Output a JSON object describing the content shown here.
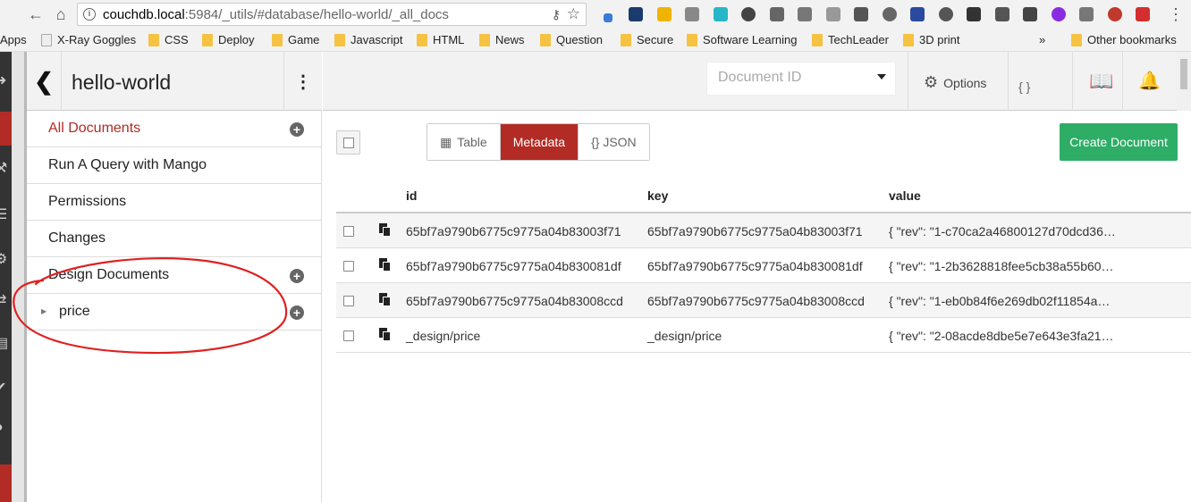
{
  "browser": {
    "url_host": "couchdb.local",
    "url_path": ":5984/_utils/#database/hello-world/_all_docs",
    "bookmarks": [
      "Apps",
      "X-Ray Goggles",
      "CSS",
      "Deploy",
      "Game",
      "Javascript",
      "HTML",
      "News",
      "Question",
      "Secure",
      "Software Learning",
      "TechLeader",
      "3D print",
      "»",
      "Other bookmarks"
    ]
  },
  "sidebar": {
    "title": "hello-world",
    "items": [
      {
        "label": "All Documents",
        "active": true,
        "has_add": true
      },
      {
        "label": "Run A Query with Mango",
        "active": false,
        "has_add": false
      },
      {
        "label": "Permissions",
        "active": false,
        "has_add": false
      },
      {
        "label": "Changes",
        "active": false,
        "has_add": false
      },
      {
        "label": "Design Documents",
        "active": false,
        "has_add": true
      },
      {
        "label": "price",
        "active": false,
        "has_add": true,
        "sub": true
      }
    ]
  },
  "header": {
    "docid_placeholder": "Document ID",
    "options_label": "Options",
    "json_peek": "{ } JSON"
  },
  "toolbar": {
    "view_modes": [
      "Table",
      "Metadata",
      "{} JSON"
    ],
    "active_view": "Metadata",
    "create_label": "Create Document"
  },
  "table": {
    "columns": [
      "id",
      "key",
      "value"
    ],
    "rows": [
      {
        "id": "65bf7a9790b6775c9775a04b83003f71",
        "key": "65bf7a9790b6775c9775a04b83003f71",
        "value": "{ \"rev\": \"1-c70ca2a46800127d70dcd36…"
      },
      {
        "id": "65bf7a9790b6775c9775a04b830081df",
        "key": "65bf7a9790b6775c9775a04b830081df",
        "value": "{ \"rev\": \"1-2b3628818fee5cb38a55b60…"
      },
      {
        "id": "65bf7a9790b6775c9775a04b83008ccd",
        "key": "65bf7a9790b6775c9775a04b83008ccd",
        "value": "{ \"rev\": \"1-eb0b84f6e269db02f11854a…"
      },
      {
        "id": "_design/price",
        "key": "_design/price",
        "value": "{ \"rev\": \"2-08acde8dbe5e7e643e3fa21…"
      }
    ]
  },
  "colors": {
    "accent": "#b22c25",
    "create": "#2dad66",
    "annotation": "#e02020"
  }
}
